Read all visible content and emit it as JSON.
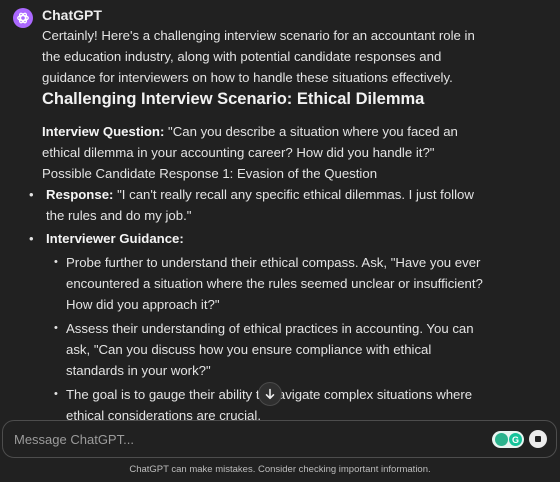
{
  "message": {
    "author": "ChatGPT",
    "intro": "Certainly! Here's a challenging interview scenario for an accountant role in the education industry, along with potential candidate responses and guidance for interviewers on how to handle these situations effectively.",
    "heading": "Challenging Interview Scenario: Ethical Dilemma",
    "question_label": "Interview Question:",
    "question_text": " \"Can you describe a situation where you faced an ethical dilemma in your accounting career? How did you handle it?\"",
    "response_title": "Possible Candidate Response 1: Evasion of the Question",
    "response_label": "Response:",
    "response_text": " \"I can't really recall any specific ethical dilemmas. I just follow the rules and do my job.\"",
    "guidance_label": "Interviewer Guidance:",
    "guidance_items": [
      "Probe further to understand their ethical compass. Ask, \"Have you ever encountered a situation where the rules seemed unclear or insufficient? How did you approach it?\"",
      "Assess their understanding of ethical practices in accounting. You can ask, \"Can you discuss how you ensure compliance with ethical standards in your work?\"",
      "The goal is to gauge their ability to navigate complex situations where ethical considerations are crucial."
    ]
  },
  "composer": {
    "placeholder": "Message ChatGPT...",
    "badge_letter": "G"
  },
  "footer": {
    "disclaimer": "ChatGPT can make mistakes. Consider checking important information."
  },
  "icons": {
    "avatar": "openai-logo-icon",
    "scroll": "arrow-down-icon",
    "grammar": "grammarly-icon",
    "stop": "stop-icon"
  },
  "colors": {
    "background": "#212121",
    "avatar": "#ab68ff",
    "grammarly": "#15c39a"
  }
}
